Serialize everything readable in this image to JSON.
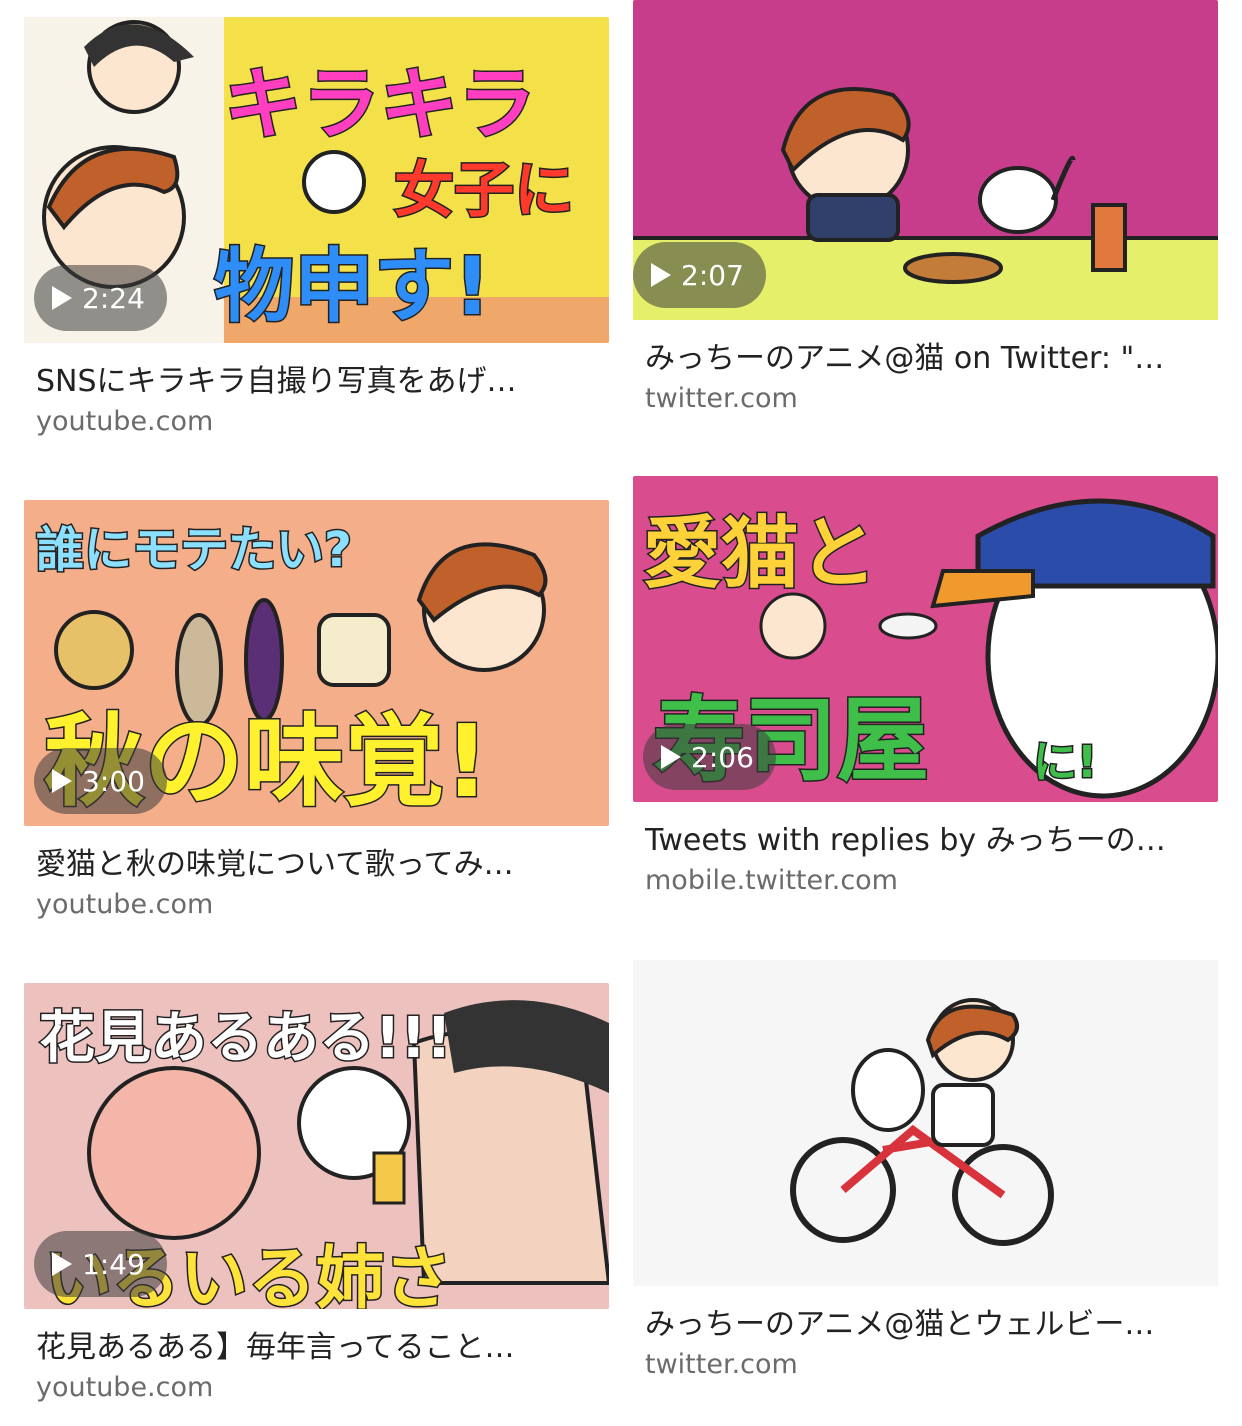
{
  "results": [
    {
      "title": "SNSにキラキラ自撮り写真をあげ…",
      "source": "youtube.com",
      "duration": "2:24",
      "thumb_text": [
        "キラキラ",
        "女子に",
        "物申す!"
      ]
    },
    {
      "title": "みっちーのアニメ@猫 on Twitter: \"…",
      "source": "twitter.com",
      "duration": "2:07",
      "thumb_text": []
    },
    {
      "title": "愛猫と秋の味覚について歌ってみ…",
      "source": "youtube.com",
      "duration": "3:00",
      "thumb_text": [
        "誰にモテたい?",
        "秋の味覚!"
      ]
    },
    {
      "title": "Tweets with replies by みっちーの…",
      "source": "mobile.twitter.com",
      "duration": "2:06",
      "thumb_text": [
        "愛猫と",
        "寿司屋",
        "に!"
      ]
    },
    {
      "title": "花見あるある】毎年言ってること…",
      "source": "youtube.com",
      "duration": "1:49",
      "thumb_text": [
        "花見あるある!!!",
        "いるいる姉さん!!!"
      ]
    },
    {
      "title": "みっちーのアニメ@猫とウェルビー…",
      "source": "twitter.com",
      "duration": "",
      "thumb_text": []
    }
  ]
}
